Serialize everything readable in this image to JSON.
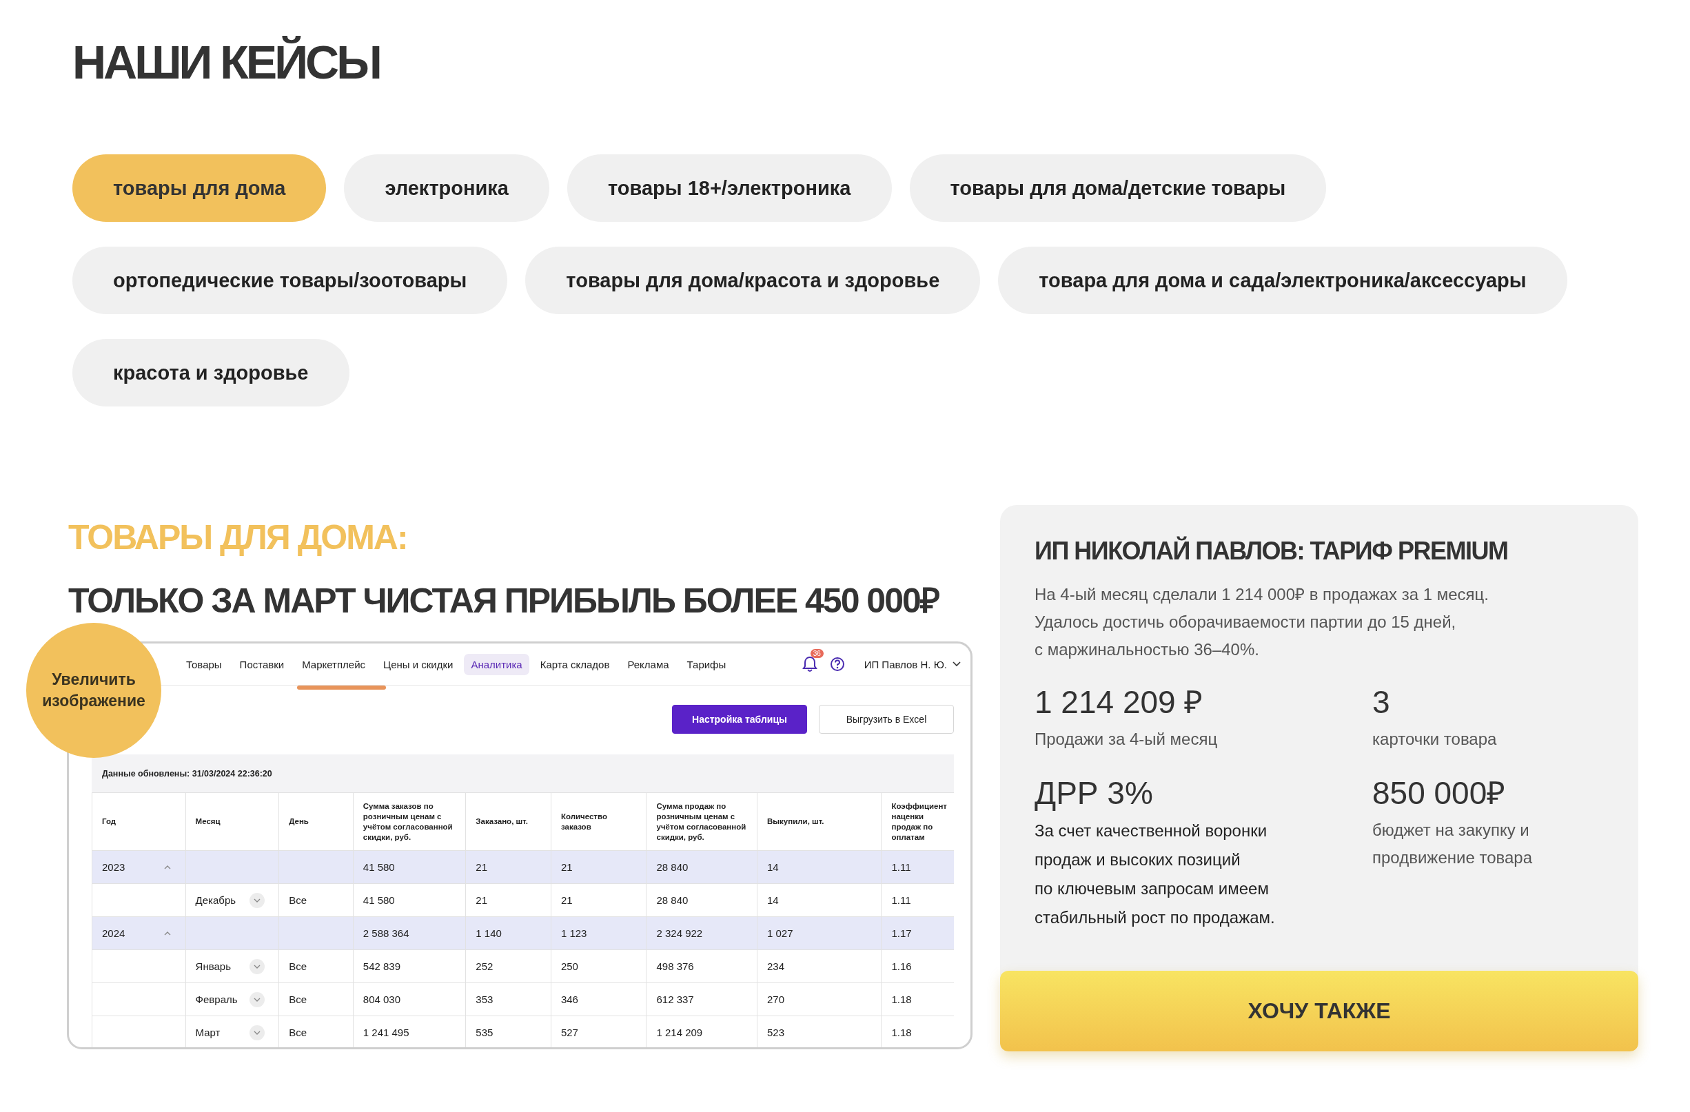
{
  "heading": "НАШИ КЕЙСЫ",
  "categories": [
    {
      "label": "товары для дома",
      "selected": true
    },
    {
      "label": "электроника",
      "selected": false
    },
    {
      "label": "товары 18+/электроника",
      "selected": false
    },
    {
      "label": "товары для дома/детские товары",
      "selected": false
    },
    {
      "label": "ортопедические товары/зоотовары",
      "selected": false
    },
    {
      "label": "товары для дома/красота и здоровье",
      "selected": false
    },
    {
      "label": "товара для дома и сада/электроника/аксессуары",
      "selected": false
    },
    {
      "label": "красота и здоровье",
      "selected": false
    }
  ],
  "case": {
    "kicker": "ТОВАРЫ ДЛЯ ДОМА:",
    "title": "ТОЛЬКО ЗА МАРТ ЧИСТАЯ ПРИБЫЛЬ БОЛЕЕ 450 000₽",
    "zoom_badge": "Увеличить изображение",
    "screenshot": {
      "nav": [
        {
          "label": "Товары",
          "selected": false
        },
        {
          "label": "Поставки",
          "selected": false
        },
        {
          "label": "Маркетплейс",
          "selected": false
        },
        {
          "label": "Цены и скидки",
          "selected": false
        },
        {
          "label": "Аналитика",
          "selected": true
        },
        {
          "label": "Карта складов",
          "selected": false
        },
        {
          "label": "Реклама",
          "selected": false
        },
        {
          "label": "Тарифы",
          "selected": false
        }
      ],
      "notifications": "36",
      "user": "ИП Павлов Н. Ю.",
      "buttons": [
        {
          "label": "Настройка таблицы",
          "kind": "primary"
        },
        {
          "label": "Выгрузить в Excel",
          "kind": "secondary"
        }
      ],
      "updated": "Данные обновлены: 31/03/2024 22:36:20",
      "table": {
        "columns": [
          "Год",
          "Месяц",
          "День",
          "Сумма заказов по розничным ценам с учётом согласованной скидки, руб.",
          "Заказано, шт.",
          "Количество заказов",
          "Сумма продаж по розничным ценам с учётом согласованной скидки, руб.",
          "Выкупили, шт.",
          "Коэффициент наценки продаж по оплатам"
        ],
        "rows": [
          {
            "kind": "year",
            "year": "2023",
            "expanded": true,
            "values": [
              "41 580",
              "21",
              "21",
              "28 840",
              "14",
              "1.11"
            ]
          },
          {
            "kind": "month",
            "month": "Декабрь",
            "day": "Все",
            "expanded": false,
            "values": [
              "41 580",
              "21",
              "21",
              "28 840",
              "14",
              "1.11"
            ]
          },
          {
            "kind": "year",
            "year": "2024",
            "expanded": true,
            "values": [
              "2 588 364",
              "1 140",
              "1 123",
              "2 324 922",
              "1 027",
              "1.17"
            ]
          },
          {
            "kind": "month",
            "month": "Январь",
            "day": "Все",
            "expanded": false,
            "values": [
              "542 839",
              "252",
              "250",
              "498 376",
              "234",
              "1.16"
            ]
          },
          {
            "kind": "month",
            "month": "Февраль",
            "day": "Все",
            "expanded": false,
            "values": [
              "804 030",
              "353",
              "346",
              "612 337",
              "270",
              "1.18"
            ]
          },
          {
            "kind": "month",
            "month": "Март",
            "day": "Все",
            "expanded": false,
            "values": [
              "1 241 495",
              "535",
              "527",
              "1 214 209",
              "523",
              "1.18"
            ]
          }
        ]
      }
    }
  },
  "card": {
    "title": "ИП НИКОЛАЙ ПАВЛОВ: ТАРИФ PREMIUM",
    "text": "На 4-ый месяц сделали 1 214 000₽ в продажах за 1 месяц.\nУдалось достичь оборачиваемости партии до 15 дней,\nс маржинальностью 36–40%.",
    "stats": [
      {
        "value": "1 214 209 ₽",
        "label": "Продажи за 4-ый месяц",
        "kind": "muted"
      },
      {
        "value": "3",
        "label": "карточки товара",
        "kind": "muted"
      },
      {
        "value": "ДРР 3%",
        "label": "За счет качественной воронки\nпродаж и высоких позиций\nпо ключевым запросам имеем\nстабильный рост по продажам.",
        "kind": "dark"
      },
      {
        "value": "850 000₽",
        "label": "бюджет на закупку и\nпродвижение товара",
        "kind": "muted"
      }
    ],
    "button": "ХОЧУ ТАКЖЕ"
  }
}
